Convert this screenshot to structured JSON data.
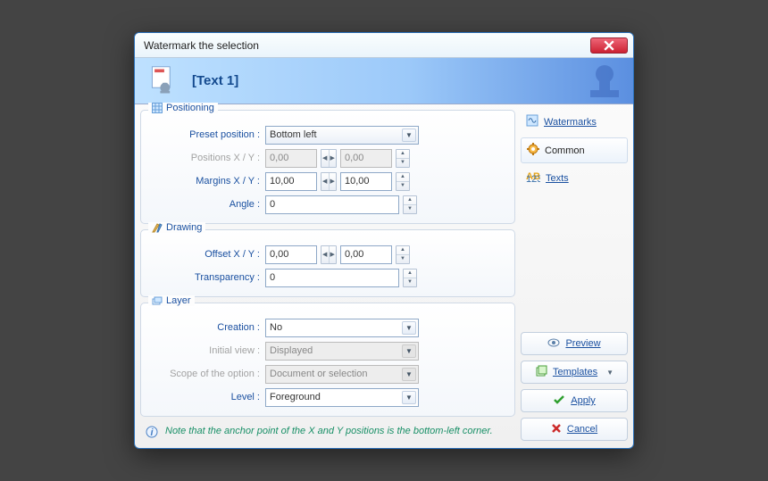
{
  "window": {
    "title": "Watermark the selection"
  },
  "header": {
    "title": "[Text 1]"
  },
  "tabs": {
    "watermarks": "Watermarks",
    "common": "Common",
    "texts": "Texts"
  },
  "groups": {
    "positioning": {
      "legend": "Positioning",
      "preset_label": "Preset position :",
      "preset_value": "Bottom left",
      "positions_label": "Positions X / Y :",
      "pos_x": "0,00",
      "pos_y": "0,00",
      "margins_label": "Margins X / Y :",
      "margin_x": "10,00",
      "margin_y": "10,00",
      "angle_label": "Angle :",
      "angle": "0"
    },
    "drawing": {
      "legend": "Drawing",
      "offset_label": "Offset X / Y :",
      "offset_x": "0,00",
      "offset_y": "0,00",
      "transparency_label": "Transparency :",
      "transparency": "0"
    },
    "layer": {
      "legend": "Layer",
      "creation_label": "Creation :",
      "creation_value": "No",
      "initialview_label": "Initial view :",
      "initialview_value": "Displayed",
      "scope_label": "Scope of the option :",
      "scope_value": "Document or selection",
      "level_label": "Level :",
      "level_value": "Foreground"
    }
  },
  "note": "Note that the anchor point of the X and Y positions is the bottom-left corner.",
  "actions": {
    "preview": "Preview",
    "templates": "Templates",
    "apply": "Apply",
    "cancel": "Cancel"
  }
}
